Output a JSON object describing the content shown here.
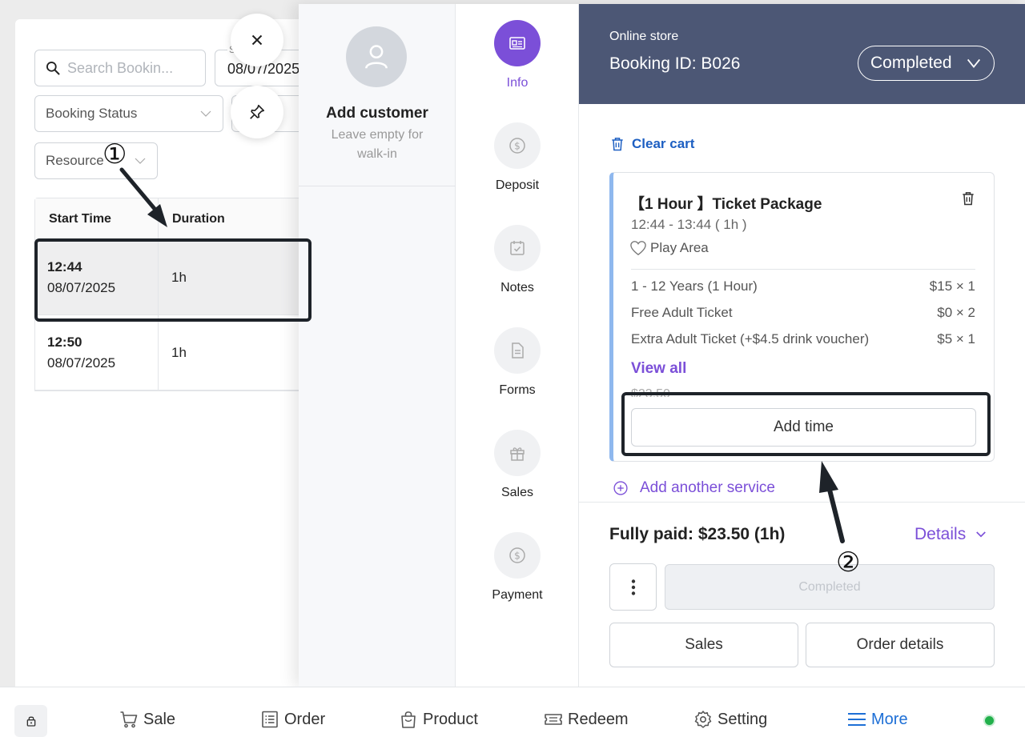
{
  "left": {
    "search_placeholder": "Search Bookin...",
    "date_field_label": "S",
    "date_value": "08/07/2025",
    "booking_status_placeholder": "Booking Status",
    "resource_placeholder": "Resource",
    "columns": [
      "Start Time",
      "Duration"
    ],
    "rows": [
      {
        "time": "12:44",
        "date": "08/07/2025",
        "duration": "1h"
      },
      {
        "time": "12:50",
        "date": "08/07/2025",
        "duration": "1h"
      }
    ]
  },
  "customer": {
    "title": "Add customer",
    "subtitle": "Leave empty for walk-in"
  },
  "side_nav": [
    {
      "label": "Info",
      "icon": "id-card-icon",
      "active": true
    },
    {
      "label": "Deposit",
      "icon": "dollar-coin-icon",
      "active": false
    },
    {
      "label": "Notes",
      "icon": "calendar-check-icon",
      "active": false
    },
    {
      "label": "Forms",
      "icon": "document-icon",
      "active": false
    },
    {
      "label": "Sales",
      "icon": "gift-icon",
      "active": false
    },
    {
      "label": "Payment",
      "icon": "dollar-coin-icon",
      "active": false
    }
  ],
  "header": {
    "source": "Online store",
    "booking_id": "Booking ID: B026",
    "status": "Completed"
  },
  "cart": {
    "clear_label": "Clear cart",
    "item_title": "【1 Hour 】Ticket Package",
    "time_range": "12:44 - 13:44 ( 1h )",
    "area": "Play Area",
    "lines": [
      {
        "name": "1 - 12 Years (1 Hour)",
        "price": "$15 × 1"
      },
      {
        "name": "Free Adult Ticket",
        "price": "$0 × 2"
      },
      {
        "name": "Extra Adult Ticket (+$4.5 drink voucher)",
        "price": "$5 × 1"
      }
    ],
    "view_all": "View all",
    "subtotal_struck": "$23.50",
    "add_time": "Add time",
    "add_service": "Add another service"
  },
  "summary": {
    "paid": "Fully paid: $23.50 (1h)",
    "details": "Details",
    "completed_button": "Completed",
    "sales_button": "Sales",
    "order_details_button": "Order details"
  },
  "bottom_nav": [
    {
      "label": "Sale",
      "icon": "cart-icon"
    },
    {
      "label": "Order",
      "icon": "list-icon"
    },
    {
      "label": "Product",
      "icon": "bag-icon"
    },
    {
      "label": "Redeem",
      "icon": "ticket-icon"
    },
    {
      "label": "Setting",
      "icon": "gear-icon"
    },
    {
      "label": "More",
      "icon": "menu-icon",
      "active": true
    }
  ],
  "annotations": {
    "marker_1": "①",
    "marker_2": "②"
  },
  "colors": {
    "accent_purple": "#7b4fd8",
    "header_bg": "#4c5775",
    "link_blue": "#1d5fc2",
    "online_green": "#22b04b"
  }
}
